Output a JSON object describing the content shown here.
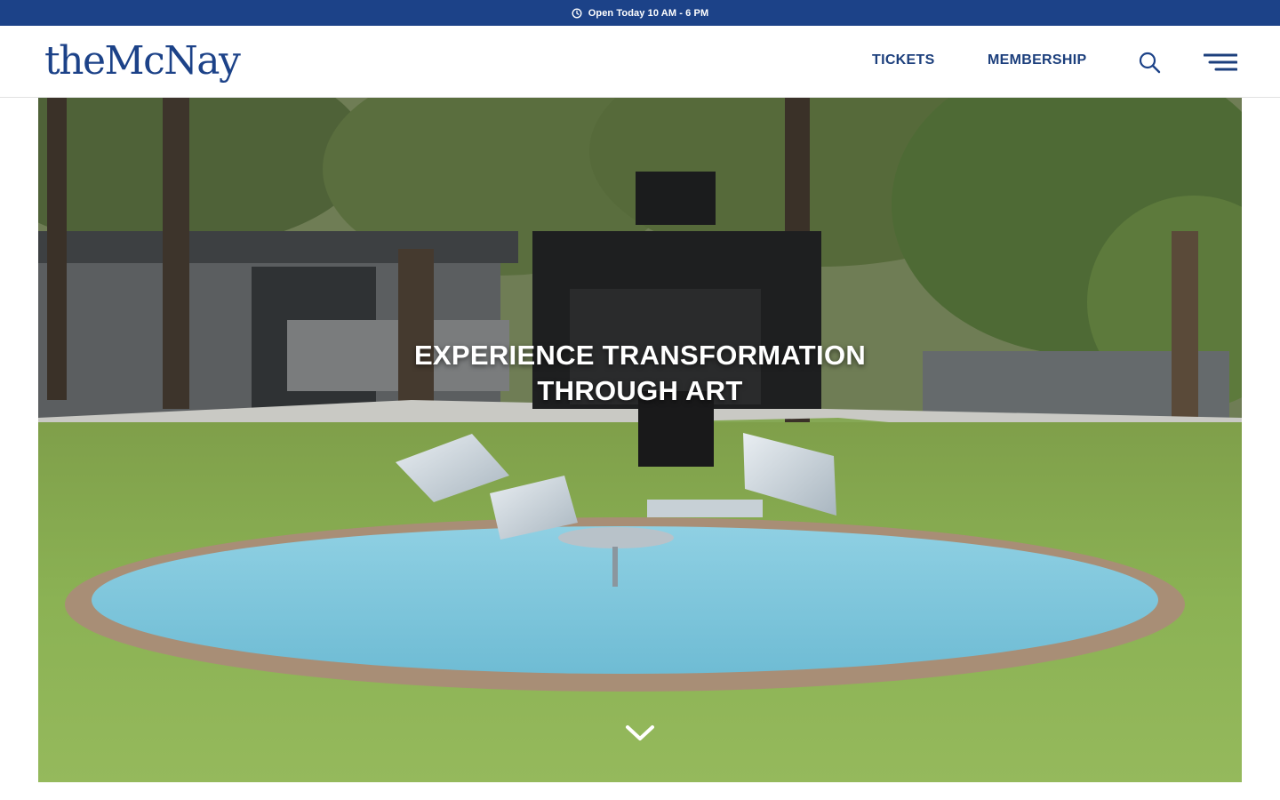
{
  "topbar": {
    "hours_text": "Open Today 10 AM - 6 PM",
    "icon": "clock-icon",
    "background_color": "#1c4288"
  },
  "header": {
    "logo_text": "theMcNay",
    "nav": {
      "tickets_label": "TICKETS",
      "membership_label": "MEMBERSHIP"
    },
    "search_icon": "search-icon",
    "menu_icon": "hamburger-menu-icon",
    "brand_color": "#1c4288"
  },
  "hero": {
    "title_line1": "EXPERIENCE TRANSFORMATION",
    "title_line2": "THROUGH ART",
    "scroll_icon": "chevron-down-icon",
    "image_description_icon": "hero-photo"
  }
}
